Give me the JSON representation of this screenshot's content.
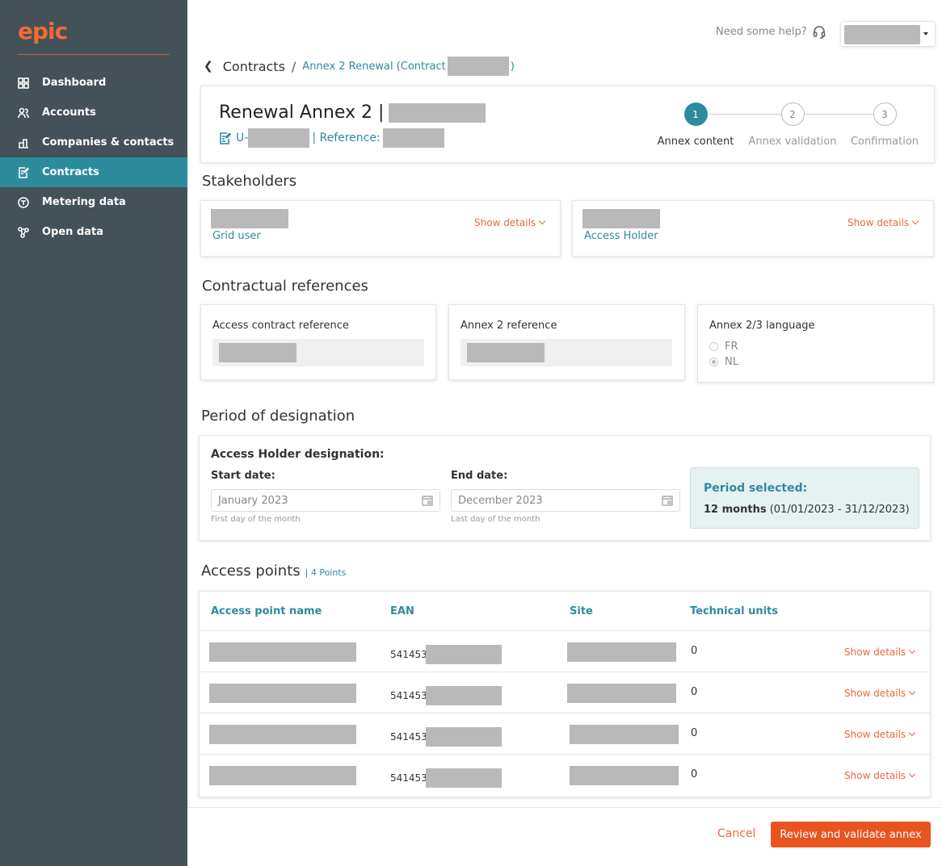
{
  "app": {
    "logo": "epic"
  },
  "sidebar": {
    "items": [
      {
        "label": "Dashboard",
        "icon": "dashboard-icon",
        "active": false
      },
      {
        "label": "Accounts",
        "icon": "users-icon",
        "active": false
      },
      {
        "label": "Companies & contacts",
        "icon": "building-icon",
        "active": false
      },
      {
        "label": "Contracts",
        "icon": "contract-edit-icon",
        "active": true
      },
      {
        "label": "Metering data",
        "icon": "meter-icon",
        "active": false
      },
      {
        "label": "Open data",
        "icon": "network-icon",
        "active": false
      }
    ]
  },
  "header": {
    "help_text": "Need some help?"
  },
  "breadcrumb": {
    "root": "Contracts",
    "separator": "/",
    "current": "Annex 2 Renewal (Contract",
    "close": ")"
  },
  "title_card": {
    "title": "Renewal Annex 2 |",
    "sub_prefix": "U-",
    "sub_reference": "| Reference:"
  },
  "stepper": {
    "steps": [
      {
        "number": "1",
        "label": "Annex content",
        "active": true
      },
      {
        "number": "2",
        "label": "Annex validation",
        "active": false
      },
      {
        "number": "3",
        "label": "Confirmation",
        "active": false
      }
    ]
  },
  "stakeholders": {
    "title": "Stakeholders",
    "show_details": "Show details",
    "cards": [
      {
        "role": "Grid user"
      },
      {
        "role": "Access Holder"
      }
    ]
  },
  "contractual_references": {
    "title": "Contractual references",
    "access_contract_reference": "Access contract reference",
    "annex2_reference": "Annex 2 reference",
    "language_label": "Annex 2/3 language",
    "languages": [
      {
        "code": "FR",
        "checked": false
      },
      {
        "code": "NL",
        "checked": true
      }
    ]
  },
  "period": {
    "title": "Period of designation",
    "designation_label": "Access Holder designation:",
    "start_label": "Start date:",
    "start_value": "January 2023",
    "start_hint": "First day of the month",
    "end_label": "End date:",
    "end_value": "December 2023",
    "end_hint": "Last day of the month",
    "selected_label": "Period selected:",
    "selected_months": "12 months",
    "selected_range": "(01/01/2023 - 31/12/2023)"
  },
  "access_points": {
    "title": "Access points",
    "count": "| 4 Points",
    "columns": [
      "Access point name",
      "EAN",
      "Site",
      "Technical units"
    ],
    "show_details": "Show details",
    "rows": [
      {
        "ean_prefix": "541453",
        "technical_units": "0"
      },
      {
        "ean_prefix": "541453",
        "technical_units": "0"
      },
      {
        "ean_prefix": "541453",
        "technical_units": "0"
      },
      {
        "ean_prefix": "541453",
        "technical_units": "0"
      }
    ]
  },
  "footer": {
    "cancel": "Cancel",
    "primary": "Review and validate annex"
  },
  "colors": {
    "sidebar_bg": "#455158",
    "accent": "#2c8c9d",
    "brand_orange": "#e8541f"
  }
}
